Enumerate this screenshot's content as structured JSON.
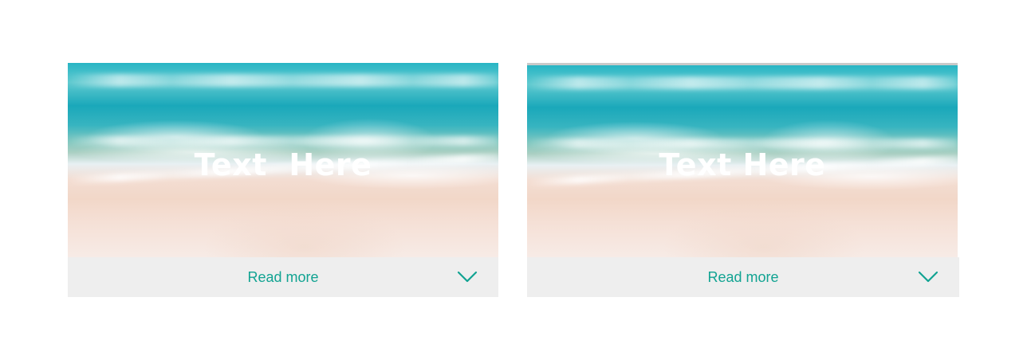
{
  "cards": [
    {
      "title": "Text  Here",
      "link_label": "Read more"
    },
    {
      "title": "Text Here",
      "link_label": "Read more"
    }
  ],
  "colors": {
    "accent": "#11a392",
    "footer_bg": "#eeeeee",
    "title": "#ffffff"
  },
  "icons": {
    "expand": "chevron-down-icon"
  }
}
